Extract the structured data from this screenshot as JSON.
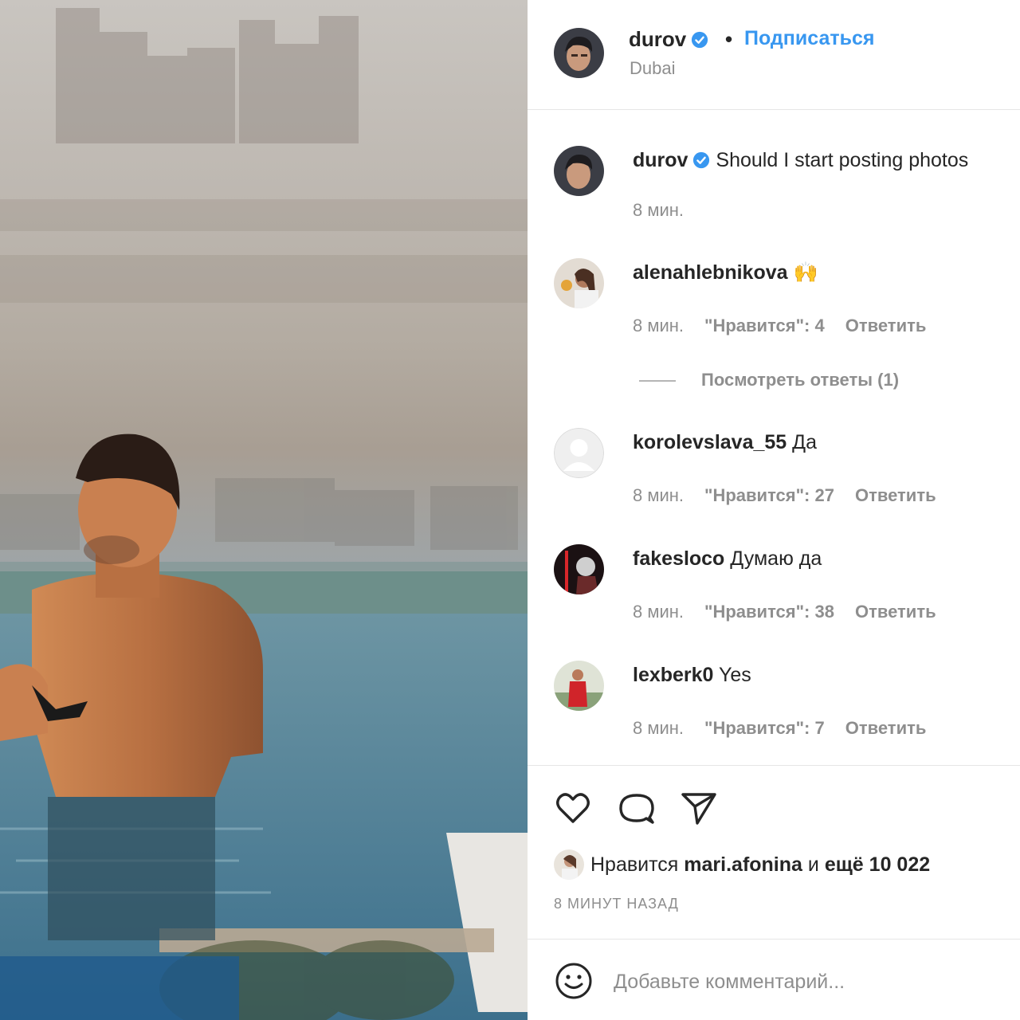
{
  "post": {
    "author": "durov",
    "follow_label": "Подписаться",
    "location": "Dubai",
    "caption_author": "durov",
    "caption_text": "Should I start posting photos",
    "caption_time": "8 мин."
  },
  "comments": [
    {
      "user": "alenahlebnikova",
      "text": "🙌",
      "time": "8 мин.",
      "likes": "\"Нравится\": 4",
      "reply": "Ответить",
      "view_replies": "Посмотреть ответы (1)"
    },
    {
      "user": "korolevslava_55",
      "text": "Да",
      "time": "8 мин.",
      "likes": "\"Нравится\": 27",
      "reply": "Ответить"
    },
    {
      "user": "fakesloco",
      "text": "Думаю да",
      "time": "8 мин.",
      "likes": "\"Нравится\": 38",
      "reply": "Ответить"
    },
    {
      "user": "lexberk0",
      "text": "Yes",
      "time": "8 мин.",
      "likes": "\"Нравится\": 7",
      "reply": "Ответить"
    }
  ],
  "likes_summary": {
    "prefix": "Нравится",
    "user": "mari.afonina",
    "middle": "и",
    "rest": "ещё 10 022"
  },
  "posted_ago": "8 МИНУТ НАЗАД",
  "comment_input": {
    "placeholder": "Добавьте комментарий..."
  },
  "icons": [
    "heart-icon",
    "comment-icon",
    "share-icon",
    "verified-icon",
    "emoji-icon"
  ],
  "colors": {
    "link": "#3897f0",
    "text": "#262626",
    "muted": "#8e8e8e",
    "verified": "#3897f0"
  }
}
